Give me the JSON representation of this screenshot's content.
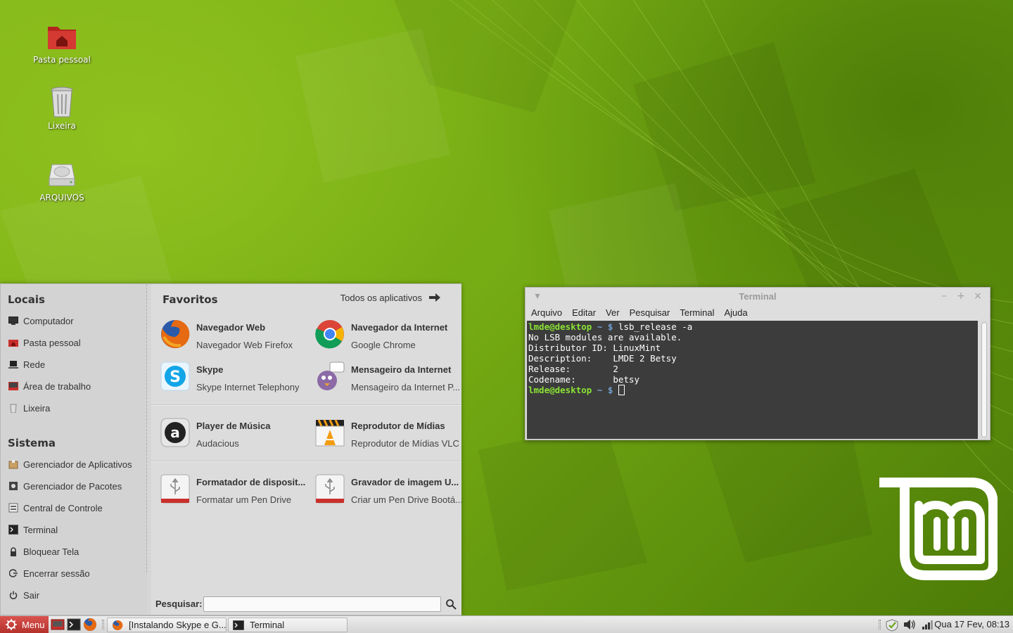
{
  "desktop": {
    "icons": [
      {
        "label": "Pasta pessoal",
        "icon": "home-folder-icon"
      },
      {
        "label": "Lixeira",
        "icon": "trash-icon"
      },
      {
        "label": "ARQUIVOS",
        "icon": "drive-icon"
      }
    ]
  },
  "menu": {
    "places_title": "Locais",
    "places": [
      {
        "label": "Computador",
        "icon": "computer-icon"
      },
      {
        "label": "Pasta pessoal",
        "icon": "home-icon"
      },
      {
        "label": "Rede",
        "icon": "network-icon"
      },
      {
        "label": "Área de trabalho",
        "icon": "desktop-icon"
      },
      {
        "label": "Lixeira",
        "icon": "trash-icon"
      }
    ],
    "system_title": "Sistema",
    "system": [
      {
        "label": "Gerenciador de Aplicativos",
        "icon": "software-manager-icon"
      },
      {
        "label": "Gerenciador de Pacotes",
        "icon": "package-manager-icon"
      },
      {
        "label": "Central de Controle",
        "icon": "control-center-icon"
      },
      {
        "label": "Terminal",
        "icon": "terminal-icon"
      },
      {
        "label": "Bloquear Tela",
        "icon": "lock-icon"
      },
      {
        "label": "Encerrar sessão",
        "icon": "logout-icon"
      },
      {
        "label": "Sair",
        "icon": "power-icon"
      }
    ],
    "favorites_title": "Favoritos",
    "all_apps_label": "Todos os aplicativos",
    "favorites": [
      {
        "name": "Navegador Web",
        "desc": "Navegador Web Firefox",
        "icon": "firefox-icon"
      },
      {
        "name": "Navegador da Internet",
        "desc": "Google Chrome",
        "icon": "chrome-icon"
      },
      {
        "name": "Skype",
        "desc": "Skype Internet Telephony",
        "icon": "skype-icon"
      },
      {
        "name": "Mensageiro da Internet",
        "desc": "Mensageiro da Internet P...",
        "icon": "pidgin-icon"
      },
      {
        "name": "Player de Música",
        "desc": "Audacious",
        "icon": "audacious-icon"
      },
      {
        "name": "Reprodutor de Mídias",
        "desc": "Reprodutor de Mídias VLC",
        "icon": "vlc-icon"
      },
      {
        "name": "Formatador de disposit...",
        "desc": "Formatar um Pen Drive",
        "icon": "usb-formatter-icon"
      },
      {
        "name": "Gravador de imagem U...",
        "desc": "Criar um Pen Drive Bootá...",
        "icon": "usb-writer-icon"
      }
    ],
    "search_label": "Pesquisar:",
    "search_value": ""
  },
  "terminal": {
    "title": "Terminal",
    "menubar": [
      "Arquivo",
      "Editar",
      "Ver",
      "Pesquisar",
      "Terminal",
      "Ajuda"
    ],
    "prompt_user": "lmde@desktop",
    "prompt_path": "~ $",
    "command": "lsb_release -a",
    "output": [
      "No LSB modules are available.",
      "Distributor ID: LinuxMint",
      "Description:    LMDE 2 Betsy",
      "Release:        2",
      "Codename:       betsy"
    ]
  },
  "panel": {
    "menu_label": "Menu",
    "tasks": [
      {
        "label": "[Instalando Skype e G...",
        "icon": "firefox-icon"
      },
      {
        "label": "Terminal",
        "icon": "terminal-icon"
      }
    ],
    "clock": "Qua 17 Fev, 08:13"
  },
  "colors": {
    "menu_button": "#c9302c",
    "prompt_user": "#8ae234",
    "prompt_path": "#729fcf",
    "terminal_bg": "#3c3c3c"
  }
}
